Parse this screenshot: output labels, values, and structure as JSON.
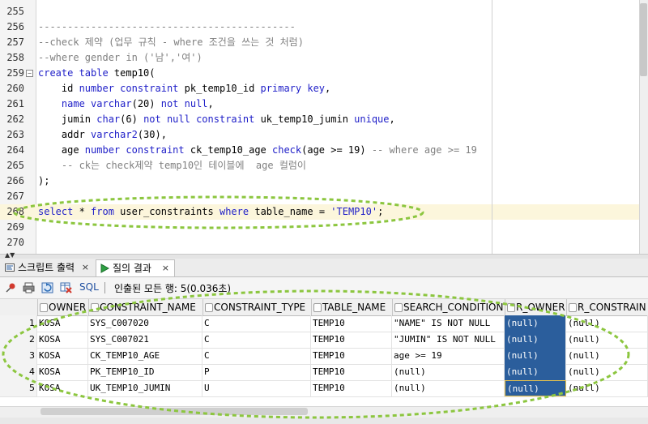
{
  "editor": {
    "lines": [
      {
        "no": "255",
        "segments": []
      },
      {
        "no": "256",
        "segments": [
          {
            "t": "cm",
            "v": "--------------------------------------------"
          }
        ]
      },
      {
        "no": "257",
        "segments": [
          {
            "t": "cm",
            "v": "--check 제약 (업무 규칙 - where 조건을 쓰는 것 처럼)"
          }
        ]
      },
      {
        "no": "258",
        "segments": [
          {
            "t": "cm",
            "v": "--where gender in ('남','여')"
          }
        ]
      },
      {
        "no": "259",
        "fold": "−",
        "segments": [
          {
            "t": "kw",
            "v": "create table "
          },
          {
            "t": "tx",
            "v": "temp10("
          }
        ]
      },
      {
        "no": "260",
        "segments": [
          {
            "t": "tx",
            "v": "    id "
          },
          {
            "t": "kw",
            "v": "number constraint "
          },
          {
            "t": "tx",
            "v": "pk_temp10_id "
          },
          {
            "t": "kw",
            "v": "primary key"
          },
          {
            "t": "tx",
            "v": ","
          }
        ]
      },
      {
        "no": "261",
        "segments": [
          {
            "t": "tx",
            "v": "    "
          },
          {
            "t": "kw",
            "v": "name varchar"
          },
          {
            "t": "tx",
            "v": "(20) "
          },
          {
            "t": "kw",
            "v": "not null"
          },
          {
            "t": "tx",
            "v": ","
          }
        ]
      },
      {
        "no": "262",
        "segments": [
          {
            "t": "tx",
            "v": "    jumin "
          },
          {
            "t": "kw",
            "v": "char"
          },
          {
            "t": "tx",
            "v": "(6) "
          },
          {
            "t": "kw",
            "v": "not null constraint "
          },
          {
            "t": "tx",
            "v": "uk_temp10_jumin "
          },
          {
            "t": "kw",
            "v": "unique"
          },
          {
            "t": "tx",
            "v": ","
          }
        ]
      },
      {
        "no": "263",
        "segments": [
          {
            "t": "tx",
            "v": "    addr "
          },
          {
            "t": "kw",
            "v": "varchar2"
          },
          {
            "t": "tx",
            "v": "(30),"
          }
        ]
      },
      {
        "no": "264",
        "segments": [
          {
            "t": "tx",
            "v": "    age "
          },
          {
            "t": "kw",
            "v": "number constraint "
          },
          {
            "t": "tx",
            "v": "ck_temp10_age "
          },
          {
            "t": "kw",
            "v": "check"
          },
          {
            "t": "tx",
            "v": "(age >= 19) "
          },
          {
            "t": "cm",
            "v": "-- where age >= 19"
          }
        ]
      },
      {
        "no": "265",
        "segments": [
          {
            "t": "cm",
            "v": "    -- ck는 check제약 temp10인 테이블에  age 컬럼이"
          }
        ]
      },
      {
        "no": "266",
        "segments": [
          {
            "t": "tx",
            "v": ");"
          }
        ]
      },
      {
        "no": "267",
        "segments": []
      },
      {
        "no": "268",
        "current": true,
        "segments": [
          {
            "t": "kw",
            "v": "select "
          },
          {
            "t": "tx",
            "v": "* "
          },
          {
            "t": "kw",
            "v": "from "
          },
          {
            "t": "tx",
            "v": "user_constraints "
          },
          {
            "t": "kw",
            "v": "where "
          },
          {
            "t": "tx",
            "v": "table_name = "
          },
          {
            "t": "st",
            "v": "'TEMP10'"
          },
          {
            "t": "tx",
            "v": ";"
          }
        ]
      },
      {
        "no": "269",
        "segments": []
      },
      {
        "no": "270",
        "segments": []
      }
    ]
  },
  "tabs": [
    {
      "label": "스크립트 출력",
      "close": "×",
      "icon": "script-output-icon"
    },
    {
      "label": "질의 결과",
      "close": "×",
      "icon": "run-triangle-icon",
      "active": true
    }
  ],
  "toolbar": {
    "sql_label": "SQL",
    "status": "인출된 모든 행: 5(0.036초)"
  },
  "grid": {
    "columns": [
      "OWNER",
      "CONSTRAINT_NAME",
      "CONSTRAINT_TYPE",
      "TABLE_NAME",
      "SEARCH_CONDITION",
      "R_OWNER",
      "R_CONSTRAIN"
    ],
    "rows": [
      [
        "1",
        "KOSA",
        "SYS_C007020",
        "C",
        "TEMP10",
        "\"NAME\" IS NOT NULL",
        "(null)",
        "(null)"
      ],
      [
        "2",
        "KOSA",
        "SYS_C007021",
        "C",
        "TEMP10",
        "\"JUMIN\" IS NOT NULL",
        "(null)",
        "(null)"
      ],
      [
        "3",
        "KOSA",
        "CK_TEMP10_AGE",
        "C",
        "TEMP10",
        "age >= 19",
        "(null)",
        "(null)"
      ],
      [
        "4",
        "KOSA",
        "PK_TEMP10_ID",
        "P",
        "TEMP10",
        "(null)",
        "(null)",
        "(null)"
      ],
      [
        "5",
        "KOSA",
        "UK_TEMP10_JUMIN",
        "U",
        "TEMP10",
        "(null)",
        "(null)",
        "(null)"
      ]
    ],
    "selected_column": 5
  },
  "colors": {
    "keyword": "#1e1ec8",
    "comment": "#808080",
    "selection": "#2b5e9c",
    "annotation": "#8cc63f"
  }
}
